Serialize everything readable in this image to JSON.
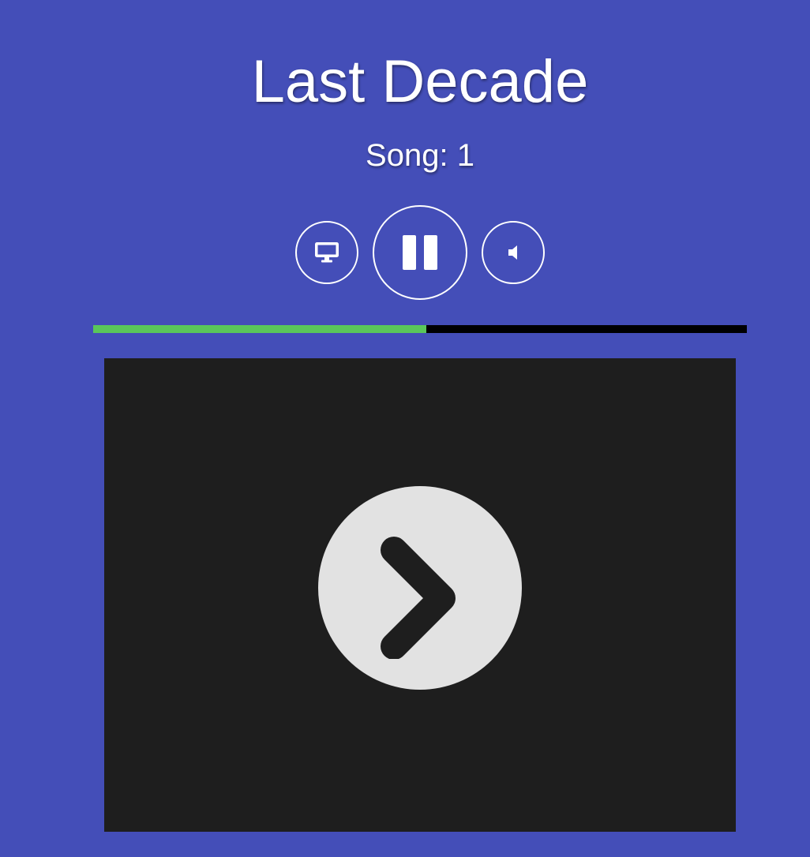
{
  "header": {
    "title": "Last Decade",
    "song_label": "Song: 1"
  },
  "controls": {
    "screen_icon": "monitor-icon",
    "playpause_icon": "pause-icon",
    "volume_icon": "speaker-icon"
  },
  "progress": {
    "fraction": 0.51
  },
  "video": {
    "overlay_icon": "chevron-right-icon"
  },
  "colors": {
    "background": "#444eb8",
    "progress_fill": "#5ac75a",
    "progress_track": "#000000",
    "video_bg": "#1e1e1e",
    "play_circle": "#e2e2e2"
  }
}
